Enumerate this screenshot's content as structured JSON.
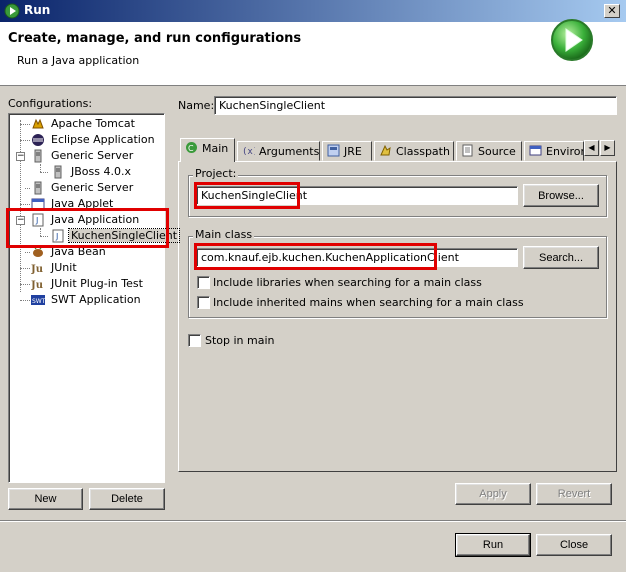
{
  "window": {
    "title": "Run",
    "close_glyph": "✕"
  },
  "header": {
    "title": "Create, manage, and run configurations",
    "subtitle": "Run a Java application",
    "icon": "run-icon"
  },
  "configurations": {
    "label": "Configurations:",
    "items": [
      {
        "label": "Apache Tomcat",
        "icon": "tomcat-icon"
      },
      {
        "label": "Eclipse Application",
        "icon": "eclipse-icon"
      },
      {
        "label": "Generic Server",
        "icon": "server-icon",
        "expanded": true
      },
      {
        "label": "JBoss 4.0.x",
        "icon": "server-icon"
      },
      {
        "label": "Generic Server",
        "icon": "server-icon"
      },
      {
        "label": "Java Applet",
        "icon": "applet-icon"
      },
      {
        "label": "Java Application",
        "icon": "java-app-icon",
        "expanded": true
      },
      {
        "label": "KuchenSingleClient",
        "icon": "java-app-icon",
        "selected": true
      },
      {
        "label": "Java Bean",
        "icon": "bean-icon"
      },
      {
        "label": "JUnit",
        "icon": "junit-icon"
      },
      {
        "label": "JUnit Plug-in Test",
        "icon": "junit-icon"
      },
      {
        "label": "SWT Application",
        "icon": "swt-icon"
      }
    ],
    "new_button": "New",
    "delete_button": "Delete"
  },
  "name": {
    "label": "Name:",
    "value": "KuchenSingleClient"
  },
  "tabs": [
    {
      "label": "Main",
      "icon": "main-tab-icon",
      "active": true
    },
    {
      "label": "Arguments",
      "icon": "arguments-icon"
    },
    {
      "label": "JRE",
      "icon": "jre-icon"
    },
    {
      "label": "Classpath",
      "icon": "classpath-icon"
    },
    {
      "label": "Source",
      "icon": "source-icon"
    },
    {
      "label": "Environ",
      "icon": "environment-icon"
    }
  ],
  "project": {
    "label": "Project:",
    "value": "KuchenSingleClient",
    "browse": "Browse..."
  },
  "main_class": {
    "label": "Main class",
    "value": "com.knauf.ejb.kuchen.KuchenApplicationClient",
    "search": "Search...",
    "include_libraries": "Include libraries when searching for a main class",
    "include_inherited": "Include inherited mains when searching for a main class"
  },
  "stop_in_main": "Stop in main",
  "apply_button": "Apply",
  "revert_button": "Revert",
  "run_button": "Run",
  "close_button": "Close",
  "colors": {
    "highlight": "#e00000",
    "titlebar": "#0a246a",
    "face": "#d4d0c8"
  }
}
